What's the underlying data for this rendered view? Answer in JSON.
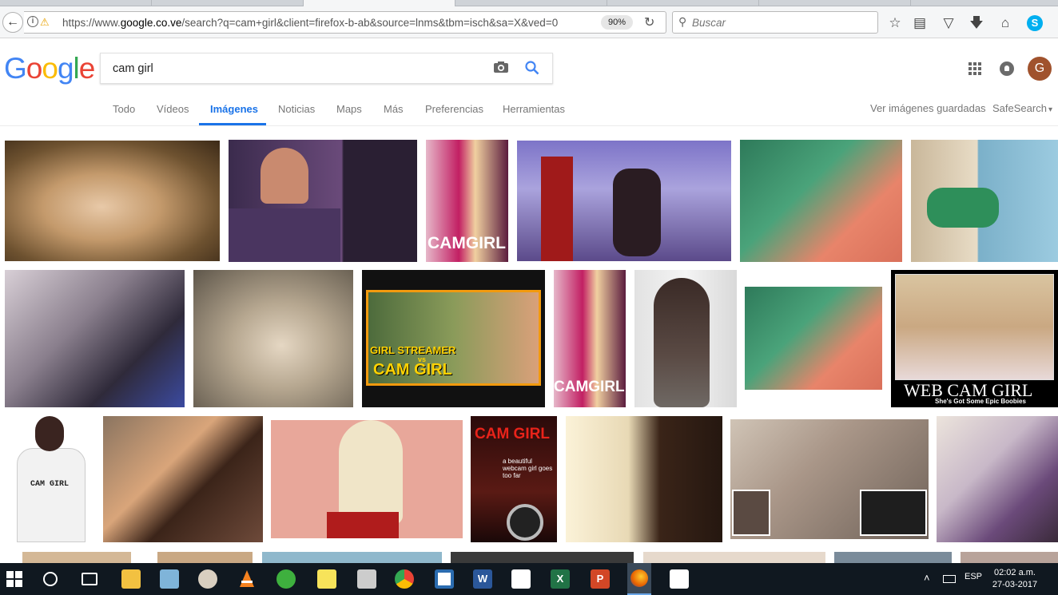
{
  "browser": {
    "url_prefix": "https://www.",
    "url_domain": "google.co.ve",
    "url_rest": "/search?q=cam+girl&client=firefox-b-ab&source=lnms&tbm=isch&sa=X&ved=0",
    "zoom": "90%",
    "search_placeholder": "Buscar"
  },
  "google": {
    "logo": [
      "G",
      "o",
      "o",
      "g",
      "l",
      "e"
    ],
    "query": "cam girl",
    "avatar_letter": "G",
    "tabs": [
      "Todo",
      "Vídeos",
      "Imágenes",
      "Noticias",
      "Maps",
      "Más",
      "Preferencias",
      "Herramientas"
    ],
    "active_tab": "Imágenes",
    "saved_images": "Ver imágenes guardadas",
    "safesearch": "SafeSearch",
    "safesearch_caret": "▾"
  },
  "results": {
    "captions": {
      "camgirl_1": "CAMGIRL",
      "camgirl_2": "CAMGIRL",
      "streamer_top": "GIRL STREAMER",
      "streamer_vs": "vs",
      "streamer_bottom": "CAM GIRL",
      "webcam_title": "WEB CAM GIRL",
      "webcam_sub": "She's Got Some Epic Boobies",
      "hoodie_text": "CAM GIRL",
      "poster_title": "CAM GIRL",
      "poster_tagline": "a beautiful webcam girl goes too far"
    }
  },
  "taskbar": {
    "language": "ESP",
    "time": "02:02 a.m.",
    "date": "27-03-2017"
  }
}
